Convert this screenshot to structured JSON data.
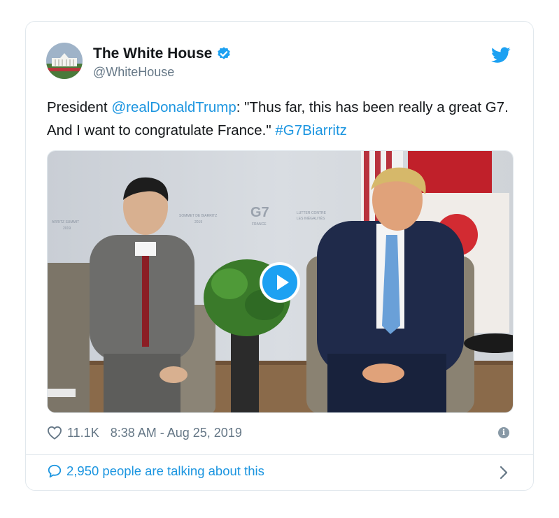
{
  "tweet": {
    "display_name": "The White House",
    "handle": "@WhiteHouse",
    "text_prefix": "President ",
    "mention": "@realDonaldTrump",
    "text_body": ": \"Thus far, this has been really a great G7. And I want to congratulate France.\" ",
    "hashtag": "#G7Biarritz",
    "likes": "11.1K",
    "timestamp": "8:38 AM - Aug 25, 2019",
    "talking": "2,950 people are talking about this"
  },
  "media": {
    "backdrop_text_left": "ARRITZ SUMMIT",
    "backdrop_year_left": "2019",
    "backdrop_text_mid": "SOMMET DE BIARRITZ",
    "backdrop_year_mid": "2019",
    "backdrop_logo": "G7",
    "backdrop_sub": "FRANCE",
    "backdrop_text_right_1": "LUTTER CONTRE",
    "backdrop_text_right_2": "LES INÉGALITÉS"
  },
  "icons": {
    "verified": "verified-badge-icon",
    "bird": "twitter-bird-icon",
    "heart": "heart-icon",
    "info": "info-icon",
    "bubble": "speech-bubble-icon",
    "chevron": "chevron-right-icon",
    "play": "play-icon"
  },
  "colors": {
    "accent": "#1da1f2",
    "link": "#1b95e0",
    "muted": "#657786",
    "border": "#e1e8ed"
  }
}
